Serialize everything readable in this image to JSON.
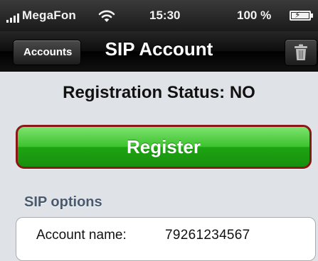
{
  "status_bar": {
    "carrier": "MegaFon",
    "time": "15:30",
    "battery_text": "100 %",
    "icons": [
      "signal-icon",
      "wifi-icon",
      "battery-charging-icon"
    ]
  },
  "nav_bar": {
    "back_label": "Accounts",
    "title": "SIP Account",
    "right_icon": "trash-icon"
  },
  "registration": {
    "status_text": "Registration Status: NO",
    "register_label": "Register",
    "register_color": "#2fb822",
    "register_border_color": "#8a1818"
  },
  "sip_options": {
    "header": "SIP options",
    "rows": [
      {
        "label": "Account name:",
        "value": "79261234567"
      }
    ]
  }
}
